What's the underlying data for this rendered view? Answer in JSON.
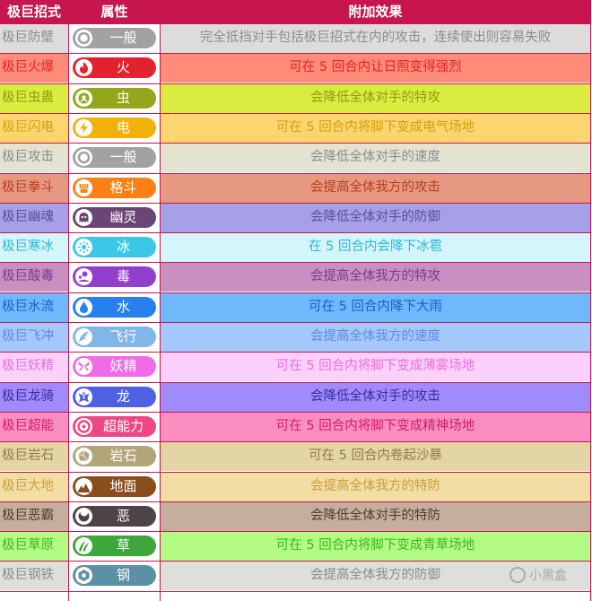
{
  "header": {
    "move": "极巨招式",
    "type": "属性",
    "effect": "附加效果"
  },
  "watermark": "小黑盒",
  "rows": [
    {
      "move": "极巨防壁",
      "type": "一般",
      "icon": "normal-icon",
      "effect": "完全抵挡对手包括极巨招式在内的攻击，连续使出则容易失败",
      "bg": "#dcdcdc",
      "fg": "#8c8c8c",
      "pill": "#a2a2a2"
    },
    {
      "move": "极巨火爆",
      "type": "火",
      "icon": "fire-icon",
      "effect": "可在 5 回合内让日照变得强烈",
      "bg": "#ff8b79",
      "fg": "#e8202a",
      "pill": "#e4222d"
    },
    {
      "move": "极巨虫蛊",
      "type": "虫",
      "icon": "bug-icon",
      "effect": "会降低全体对手的特攻",
      "bg": "#d9ec3f",
      "fg": "#8a9e11",
      "pill": "#94a61a"
    },
    {
      "move": "极巨闪电",
      "type": "电",
      "icon": "electric-icon",
      "effect": "可在 5 回合内将脚下变成电气场地",
      "bg": "#fbd56d",
      "fg": "#d8a011",
      "pill": "#f2b10a"
    },
    {
      "move": "极巨攻击",
      "type": "一般",
      "icon": "normal-icon",
      "effect": "会降低全体对手的速度",
      "bg": "#e3e3d2",
      "fg": "#8c8c8c",
      "pill": "#a2a2a2"
    },
    {
      "move": "极巨拳斗",
      "type": "格斗",
      "icon": "fighting-icon",
      "effect": "会提高全体我方的攻击",
      "bg": "#e69880",
      "fg": "#b73f1e",
      "pill": "#fb8016"
    },
    {
      "move": "极巨幽魂",
      "type": "幽灵",
      "icon": "ghost-icon",
      "effect": "会降低全体对手的防御",
      "bg": "#a5a0e8",
      "fg": "#5a4e9e",
      "pill": "#6b4575"
    },
    {
      "move": "极巨寒冰",
      "type": "冰",
      "icon": "ice-icon",
      "effect": "在 5 回合内会降下冰雹",
      "bg": "#d4f5fa",
      "fg": "#29b8d6",
      "pill": "#3ac8e6"
    },
    {
      "move": "极巨酸毒",
      "type": "毒",
      "icon": "poison-icon",
      "effect": "会提高全体我方的特攻",
      "bg": "#c98fc0",
      "fg": "#7e3a8c",
      "pill": "#9240cc"
    },
    {
      "move": "极巨水流",
      "type": "水",
      "icon": "water-icon",
      "effect": "可在 5 回合内降下大雨",
      "bg": "#6fb8fb",
      "fg": "#1b5ec8",
      "pill": "#2680ed"
    },
    {
      "move": "极巨飞冲",
      "type": "飞行",
      "icon": "flying-icon",
      "effect": "会提高全体我方的速度",
      "bg": "#a4c8fb",
      "fg": "#5a8ce6",
      "pill": "#80b6e8"
    },
    {
      "move": "极巨妖精",
      "type": "妖精",
      "icon": "fairy-icon",
      "effect": "可在 5 回合内将脚下变成薄雾场地",
      "bg": "#fbd1fb",
      "fg": "#ee6fd6",
      "pill": "#f06ce6"
    },
    {
      "move": "极巨龙骑",
      "type": "龙",
      "icon": "dragon-icon",
      "effect": "会降低全体对手的攻击",
      "bg": "#9f8bfb",
      "fg": "#3a2c9e",
      "pill": "#4f60e2"
    },
    {
      "move": "极巨超能",
      "type": "超能力",
      "icon": "psychic-icon",
      "effect": "可在 5 回合内将脚下变成精神场地",
      "bg": "#fb8ec0",
      "fg": "#d01f63",
      "pill": "#ed4882"
    },
    {
      "move": "极巨岩石",
      "type": "岩石",
      "icon": "rock-icon",
      "effect": "可在 5 回合内卷起沙暴",
      "bg": "#e4d6a4",
      "fg": "#8e7c48",
      "pill": "#b2a577"
    },
    {
      "move": "极巨大地",
      "type": "地面",
      "icon": "ground-icon",
      "effect": "会提高全体我方的特防",
      "bg": "#f2dea4",
      "fg": "#c6a03b",
      "pill": "#8a4e1e"
    },
    {
      "move": "极巨恶霸",
      "type": "恶",
      "icon": "dark-icon",
      "effect": "会降低全体对手的特防",
      "bg": "#c4ae9e",
      "fg": "#4e3c30",
      "pill": "#4e4448"
    },
    {
      "move": "极巨草原",
      "type": "草",
      "icon": "grass-icon",
      "effect": "可在 5 回合内将脚下变成青草场地",
      "bg": "#b4fb86",
      "fg": "#3ab81b",
      "pill": "#3ea73b"
    },
    {
      "move": "极巨钢铁",
      "type": "钢",
      "icon": "steel-icon",
      "effect": "会提高全体我方的防御",
      "bg": "#dededa",
      "fg": "#8c8c8c",
      "pill": "#5c90a6"
    }
  ]
}
